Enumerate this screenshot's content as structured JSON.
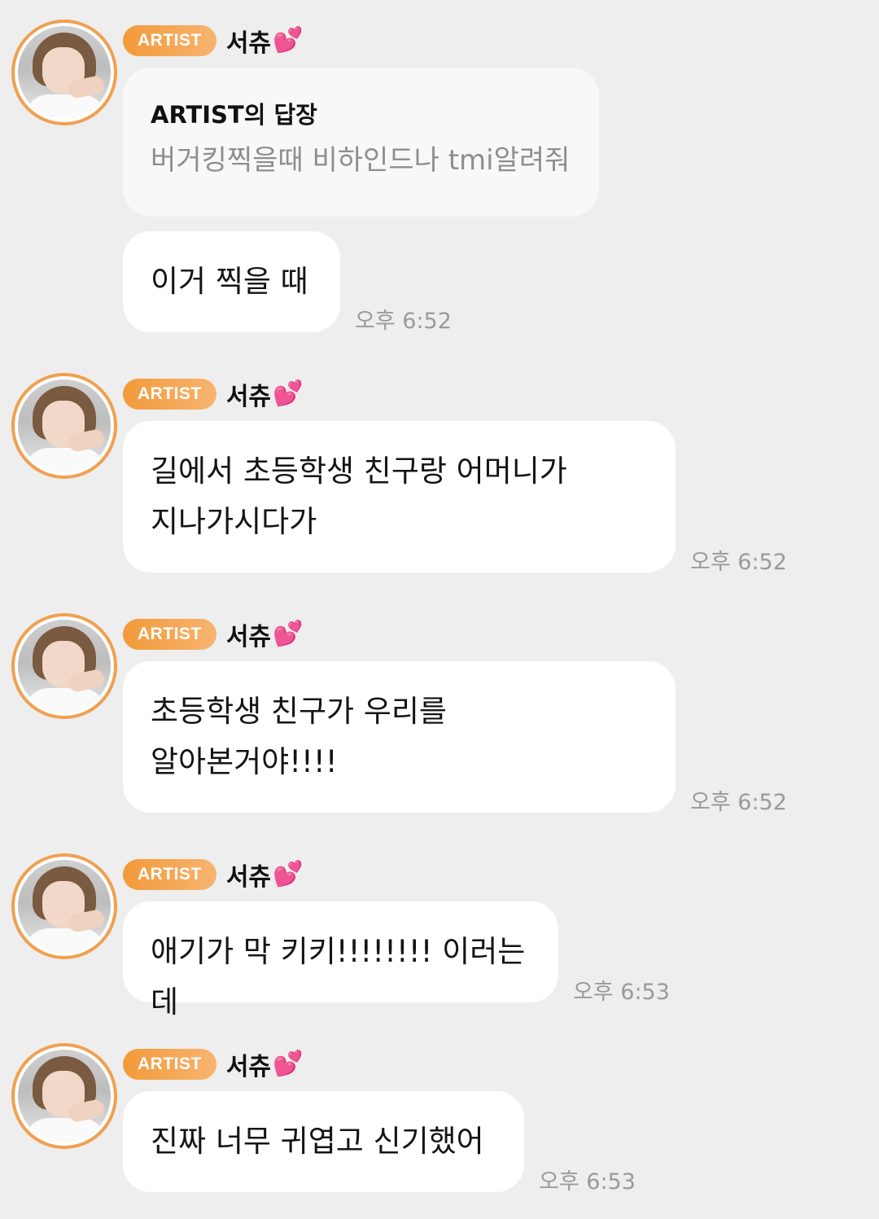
{
  "groups": [
    {
      "badge": "ARTIST",
      "name": "서츄",
      "heart_icon": "💕",
      "reply": {
        "title": "ARTIST의 답장",
        "text": "버거킹찍을때 비하인드나 tmi알려줘"
      },
      "message": "이거 찍을 때",
      "time": "오후 6:52"
    },
    {
      "badge": "ARTIST",
      "name": "서츄",
      "heart_icon": "💕",
      "line1": "길에서 초등학생 친구랑 어머니가",
      "line2": "지나가시다가",
      "time": "오후 6:52"
    },
    {
      "badge": "ARTIST",
      "name": "서츄",
      "heart_icon": "💕",
      "line1": "초등학생 친구가 우리를",
      "line2": "알아본거야!!!!",
      "time": "오후 6:52"
    },
    {
      "badge": "ARTIST",
      "name": "서츄",
      "heart_icon": "💕",
      "message": "애기가 막 키키!!!!!!!! 이러는데",
      "time": "오후 6:53"
    },
    {
      "badge": "ARTIST",
      "name": "서츄",
      "heart_icon": "💕",
      "message": "진짜 너무 귀엽고 신기했어",
      "time": "오후 6:53"
    }
  ],
  "colors": {
    "background": "#eeeeee",
    "badge_gradient_start": "#f29a3a",
    "badge_gradient_end": "#f7b470",
    "avatar_ring": "#f0a050",
    "bubble": "#ffffff",
    "timestamp": "#9a9a9a"
  }
}
